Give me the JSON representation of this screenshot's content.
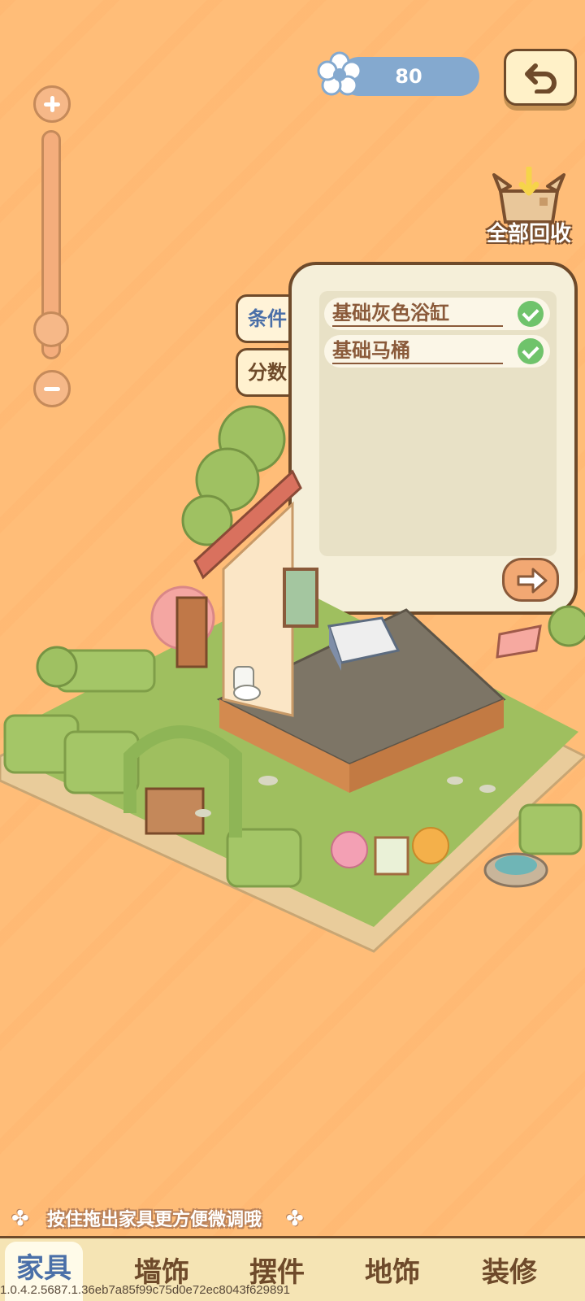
{
  "currency": {
    "value": "80",
    "icon": "flower-icon"
  },
  "header": {
    "back_icon": "undo-icon",
    "recycle_label": "全部回收"
  },
  "zoom": {
    "level": 0.08
  },
  "tabs": [
    {
      "label": "条件",
      "active": true
    },
    {
      "label": "分数",
      "active": false
    }
  ],
  "conditions": [
    {
      "label": "基础灰色浴缸",
      "done": true
    },
    {
      "label": "基础马桶",
      "done": true
    }
  ],
  "hint": {
    "text": "按住拖出家具更方便微调哦"
  },
  "bottom_nav": [
    {
      "label": "家具",
      "active": true
    },
    {
      "label": "墙饰",
      "active": false
    },
    {
      "label": "摆件",
      "active": false
    },
    {
      "label": "地饰",
      "active": false
    },
    {
      "label": "装修",
      "active": false
    }
  ],
  "version": "1.0.4.2.5687.1.36eb7a85f99c75d0e72ec8043f629891",
  "colors": {
    "background": "#ffbd78",
    "accent_blue": "#4a6fa8",
    "brown": "#6e4a2a",
    "check_green": "#6fc36b"
  }
}
